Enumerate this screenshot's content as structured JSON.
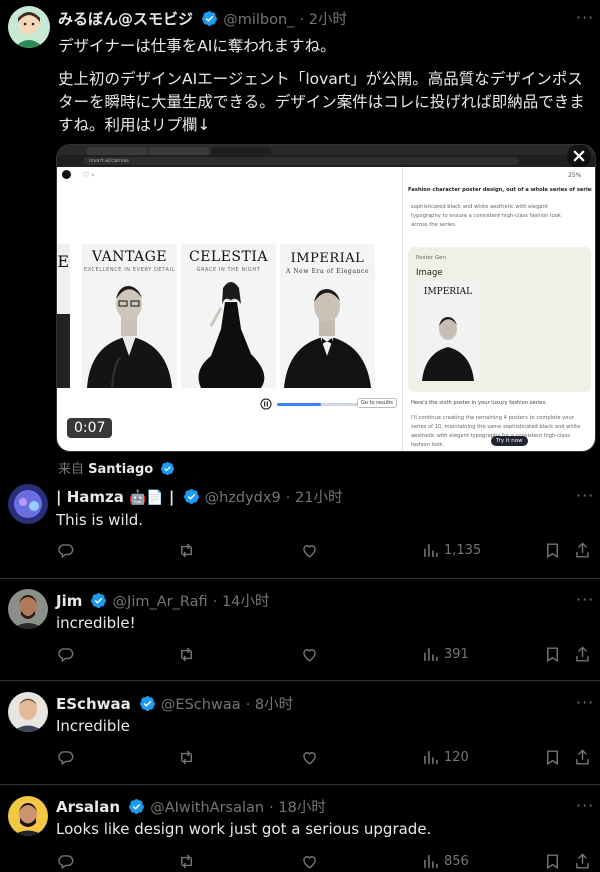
{
  "main_tweet": {
    "name": "みるぼん@スモビジ",
    "handle": "@milbon_",
    "time": "· 2小时",
    "line1": "デザイナーは仕事をAIに奪われますね。",
    "body1": "史上初のデザインAIエージェント「lovart」が公開。高品質なデザインポスターを瞬時に大量生成できる。デザイン案件はコレに投げれば即納品できますね。利用はリプ欄↓",
    "video_duration": "0:07",
    "via_label": "来自",
    "via_name": "Santiago"
  },
  "video_ui": {
    "url": "lovart.ai/canvas",
    "zoom": "25%",
    "chat_header": "Fashion character poster design, out of a whole series of series of bi...",
    "chat_text1": "sophisticated black and white aesthetic with elegant typography to ensure a consistent high-class fashion look across the series.",
    "card_tag": "Poster Gen",
    "card_title": "Image",
    "card_poster_title": "IMPERIAL",
    "chat_text2": "Here's the sixth poster in your luxury fashion series:",
    "chat_text3": "I'll continue creating the remaining 4 posters to complete your series of 10, maintaining the same sophisticated black and white aesthetic with elegant typography for a consistent high-class fashion look.",
    "try_button": "Try it now",
    "results_button": "Go to results",
    "posters": [
      {
        "title": "E",
        "sub": ""
      },
      {
        "title": "VANTAGE",
        "sub": "EXCELLENCE IN EVERY DETAIL"
      },
      {
        "title": "CELESTIA",
        "sub": "GRACE IN THE NIGHT"
      },
      {
        "title": "IMPERIAL",
        "sub": "A New Era of Elegance"
      }
    ],
    "video_progress": 0.45
  },
  "replies": [
    {
      "name": "| Hamza",
      "emoji": "🤖📄",
      "handle": "@hzdydx9",
      "time": "· 21小时",
      "text": "This is wild.",
      "views": "1,135",
      "avatar_color": "#5a5fd6"
    },
    {
      "name": "Jim",
      "handle": "@Jim_Ar_Rafi",
      "time": "· 14小时",
      "text": "incredible!",
      "views": "391",
      "avatar_color": "#6b4a3a"
    },
    {
      "name": "ESchwaa",
      "handle": "@ESchwaa",
      "time": "· 8小时",
      "text": "Incredible",
      "views": "120",
      "avatar_color": "#c9a48a"
    },
    {
      "name": "Arsalan",
      "handle": "@AIwithArsalan",
      "time": "· 18小时",
      "text": "Looks like design work just got a serious upgrade.",
      "views": "856",
      "avatar_color": "#f2c744"
    }
  ],
  "colors": {
    "verified": "#1d9bf0",
    "muted": "#71767b",
    "divider": "#2f3336",
    "text": "#e7e9ea"
  }
}
